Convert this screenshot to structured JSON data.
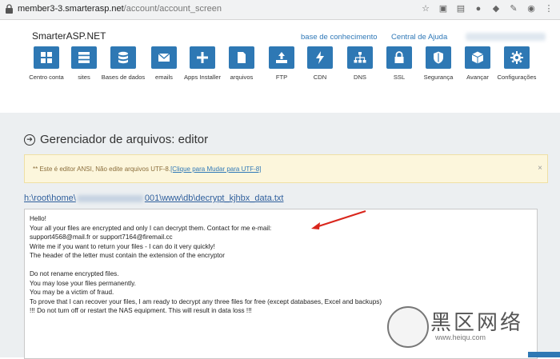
{
  "browser": {
    "url_host": "member3-3.smarterasp.net",
    "url_path": "/account/account_screen"
  },
  "header": {
    "logo": "SmarterASP.NET",
    "links": [
      "base de conhecimento",
      "Central de Ajuda"
    ]
  },
  "tools": [
    {
      "label": "Centro conta",
      "icon": "grid-icon"
    },
    {
      "label": "sites",
      "icon": "server-icon"
    },
    {
      "label": "Bases de dados",
      "icon": "database-icon"
    },
    {
      "label": "emails",
      "icon": "envelope-icon"
    },
    {
      "label": "Apps Installer",
      "icon": "plus-icon"
    },
    {
      "label": "arquivos",
      "icon": "file-icon"
    },
    {
      "label": "FTP",
      "icon": "upload-icon"
    },
    {
      "label": "CDN",
      "icon": "bolt-icon"
    },
    {
      "label": "DNS",
      "icon": "sitemap-icon"
    },
    {
      "label": "SSL",
      "icon": "lock-icon"
    },
    {
      "label": "Segurança",
      "icon": "shield-icon"
    },
    {
      "label": "Avançar",
      "icon": "cube-icon"
    },
    {
      "label": "Configurações",
      "icon": "gear-icon"
    }
  ],
  "page": {
    "title": "Gerenciador de arquivos: editor",
    "warning_text": "** Este é editor ANSI, Não edite arquivos UTF-8.",
    "warning_link": "[Clique para Mudar para UTF-8]",
    "path_prefix": "h:\\root\\home\\",
    "path_suffix": "001\\www\\db\\decrypt_kjhbx_data.txt"
  },
  "editor": {
    "content": "Hello!\nYour all your files are encrypted and only I can decrypt them. Contact for me e-mail:\nsupport4568@mail.fr or support7164@firemail.cc\nWrite me if you want to return your files - I can do it very quickly!\nThe header of the letter must contain the extension of the encryptor\n\nDo not rename encrypted files.\nYou may lose your files permanently.\nYou may be a victim of fraud.\nTo prove that I can recover your files, I am ready to decrypt any three files for free (except databases, Excel and backups)\n!!! Do not turn off or restart the NAS equipment. This will result in data loss !!!"
  },
  "watermark": {
    "big": "黑区网络",
    "small": "www.heiqu.com"
  },
  "colors": {
    "accent": "#2e78b4",
    "warning_bg": "#fcf6dc",
    "panel_bg": "#eceff1",
    "arrow": "#d9261c"
  }
}
